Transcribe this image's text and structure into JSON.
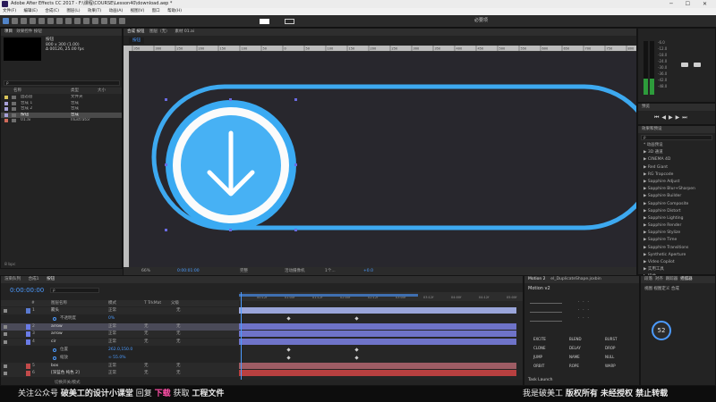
{
  "window": {
    "title": "Adobe After Effects CC 2017 - F:\\课程\\COURSE\\Lesson40\\download.aep *",
    "controls": "─ ☐ ✕"
  },
  "menu": [
    "文件(F)",
    "编辑(E)",
    "合成(C)",
    "图层(L)",
    "效果(T)",
    "动画(A)",
    "视图(V)",
    "窗口",
    "帮助(H)"
  ],
  "toolbar": {
    "workspace": "必要项"
  },
  "project": {
    "tab": "项目",
    "tab2": "效果控件 按钮",
    "name": "按钮",
    "dims": "800 x 300 (1.00)",
    "dur": "Δ 00126, 25.00 fps",
    "search_placeholder": "ρ",
    "col_name": "名称",
    "col_type": "类型",
    "col_size": "大小",
    "items": [
      {
        "name": "固态层",
        "type": "文件夹",
        "color": "#d8c35a"
      },
      {
        "name": "合成 1",
        "type": "合成",
        "color": "#a7a0d8"
      },
      {
        "name": "合成 2",
        "type": "合成",
        "color": "#a7a0d8"
      },
      {
        "name": "按钮",
        "type": "合成",
        "color": "#a7a0d8",
        "selected": true
      },
      {
        "name": "01.ai",
        "type": "Illustrator",
        "color": "#d06a5a"
      }
    ],
    "bpc": "8 bpc"
  },
  "comp": {
    "tab": "合成 按钮",
    "layer_tab": "图层（无）",
    "footage_tab": "素材 01.ai",
    "sub_tab": "按钮",
    "zoom": "66%",
    "time": "0:00:01:00",
    "quality": "完整",
    "camera": "活动摄像机",
    "views": "1个...",
    "offset": "+0.0",
    "ruler": [
      "350",
      "300",
      "250",
      "200",
      "150",
      "100",
      "50",
      "0",
      "50",
      "100",
      "150",
      "200",
      "250",
      "300",
      "350",
      "400",
      "450",
      "500",
      "550",
      "600",
      "650",
      "700",
      "750",
      "800"
    ]
  },
  "timeline": {
    "tab_render": "渲染队列",
    "tab_comp1": "合成1",
    "tab_btn": "按钮",
    "timecode": "0:00:00:00",
    "search_placeholder": "ρ",
    "col_num": "#",
    "col_name": "图层名称",
    "col_mode": "模式",
    "col_trk": "T TrkMat",
    "col_parent": "父级",
    "layers": [
      {
        "num": "1",
        "name": "箭头",
        "mode": "正常",
        "parent": "无",
        "color": "#5a7ad0",
        "bar": "#9aa5da",
        "trk": "",
        "sel": false
      },
      {
        "num": "",
        "name": "不透明度",
        "mode": "0%",
        "parent": "",
        "color": "",
        "bar": "",
        "trk": "",
        "sel": false,
        "prop": true
      },
      {
        "num": "2",
        "name": "arrow",
        "mode": "正常",
        "parent": "无",
        "color": "#6a7be6",
        "bar": "#6e73c8",
        "trk": "无",
        "sel": true
      },
      {
        "num": "3",
        "name": "arrow",
        "mode": "正常",
        "parent": "无",
        "color": "#6a7be6",
        "bar": "#6e73c8",
        "trk": "无",
        "sel": false
      },
      {
        "num": "4",
        "name": "cir",
        "mode": "正常",
        "parent": "无",
        "color": "#6a7be6",
        "bar": "#6e73c8",
        "trk": "无",
        "sel": false
      },
      {
        "num": "",
        "name": "位置",
        "mode": "262.0,150.0",
        "parent": "",
        "color": "",
        "bar": "",
        "trk": "",
        "sel": false,
        "prop": true
      },
      {
        "num": "",
        "name": "缩放",
        "mode": "∞ 55.0%",
        "parent": "",
        "color": "",
        "bar": "",
        "trk": "",
        "sel": false,
        "prop": true
      },
      {
        "num": "5",
        "name": "box",
        "mode": "正常",
        "parent": "无",
        "color": "#c24a4a",
        "bar": "#9e5c64",
        "trk": "无",
        "sel": false
      },
      {
        "num": "6",
        "name": "[深蓝色 纯色 2]",
        "mode": "正常",
        "parent": "无",
        "color": "#c24a4a",
        "bar": "#b84040",
        "trk": "无",
        "sel": false
      }
    ],
    "ruler": [
      "00:12f",
      "01:00f",
      "01:12f",
      "02:00f",
      "02:12f",
      "03:00f",
      "03:12f",
      "04:00f",
      "04:12f",
      "05:00f"
    ],
    "footer": "切换开关/模式"
  },
  "info": {
    "values": [
      "-6.0",
      "-12.0",
      "-18.0",
      "-24.0",
      "-30.0",
      "-36.0",
      "-42.0",
      "-48.0"
    ]
  },
  "preview": {
    "tab": "预览"
  },
  "effects": {
    "tab": "效果和预设",
    "search_placeholder": "ρ",
    "items": [
      "* 动画预设",
      "▶ 3D 通道",
      "▶ CINEMA 4D",
      "▶ Red Giant",
      "▶ RG Trapcode",
      "▶ Sapphire Adjust",
      "▶ Sapphire Blur+Sharpen",
      "▶ Sapphire Builder",
      "▶ Sapphire Composite",
      "▶ Sapphire Distort",
      "▶ Sapphire Lighting",
      "▶ Sapphire Render",
      "▶ Sapphire Stylize",
      "▶ Sapphire Time",
      "▶ Sapphire Transitions",
      "▶ Synthetic Aperture",
      "▶ Video Copilot",
      "▶ 实用工具",
      "▶ 扭曲",
      "▶ 抠像"
    ]
  },
  "motion": {
    "tab": "Motion 2",
    "tab2": "el_DuplicateShape.jsxbin",
    "title": "Motion v2",
    "btns": [
      "EXCITE",
      "BLEND",
      "BURST",
      "CLONE",
      "DELAY",
      "DROP",
      "JUMP",
      "NAME",
      "NULL",
      "ORBIT",
      "ROPE",
      "WARP"
    ],
    "launch": "Task Launch"
  },
  "paragraph": {
    "tab": "段落",
    "tab2": "对齐",
    "tab3": "跟踪器",
    "tab4": "摇摆器",
    "label": "视图  视图定义  合成",
    "pct": "52"
  },
  "footer": {
    "left": "关注公众号 ",
    "name": "破美工的设计小课堂",
    "reply": "  回复 ",
    "kw": "下载",
    "get": "  获取 ",
    "file": "工程文件",
    "right1": "我是破美工 ",
    "right2": "版权所有 未经授权 禁止转载"
  }
}
